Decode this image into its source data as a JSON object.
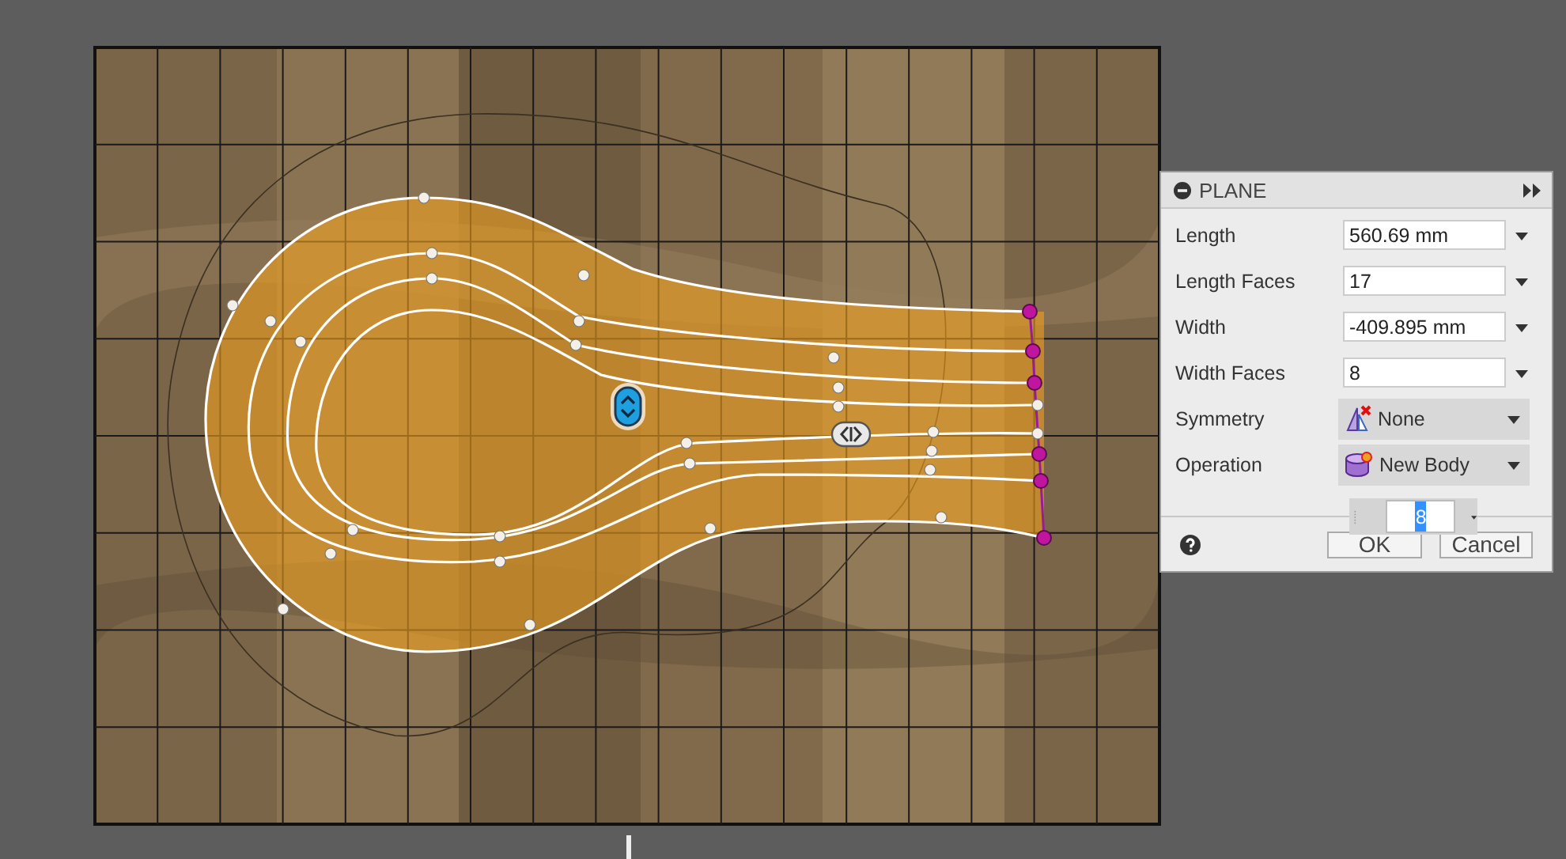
{
  "dialog": {
    "title": "PLANE",
    "rows": [
      {
        "kind": "field",
        "label": "Length",
        "value": "560.69 mm"
      },
      {
        "kind": "field",
        "label": "Length Faces",
        "value": "17"
      },
      {
        "kind": "field",
        "label": "Width",
        "value": "-409.895 mm"
      },
      {
        "kind": "field",
        "label": "Width Faces",
        "value": "8"
      },
      {
        "kind": "dropdown",
        "label": "Symmetry",
        "value": "None"
      },
      {
        "kind": "dropdown",
        "label": "Operation",
        "value": "New Body"
      }
    ],
    "buttons": [
      {
        "label": "OK"
      },
      {
        "label": "Cancel"
      }
    ]
  },
  "floating_input": {
    "value": "8",
    "selected": true
  }
}
